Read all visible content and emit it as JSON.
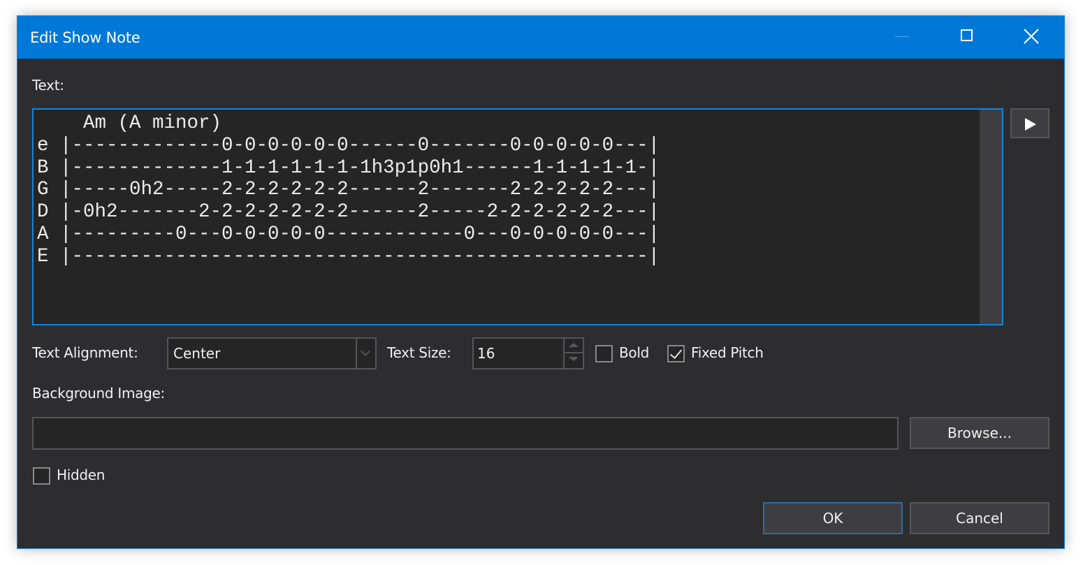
{
  "window": {
    "title": "Edit Show Note",
    "controls": {
      "minimize": "minimize-icon",
      "maximize": "maximize-icon",
      "close": "close-icon"
    },
    "accent_color": "#0078d7"
  },
  "text_field": {
    "label": "Text:",
    "lines": [
      "    Am (A minor)",
      "e |-------------0-0-0-0-0-0------0-------0-0-0-0-0---|",
      "B |-------------1-1-1-1-1-1-1h3p1p0h1------1-1-1-1-1-|",
      "G |-----0h2-----2-2-2-2-2-2------2-------2-2-2-2-2---|",
      "D |-0h2-------2-2-2-2-2-2-2------2-----2-2-2-2-2-2---|",
      "A |---------0---0-0-0-0-0------------0---0-0-0-0-0---|",
      "E |--------------------------------------------------|"
    ],
    "preview_button_icon": "play-icon"
  },
  "options": {
    "text_alignment_label": "Text Alignment:",
    "text_alignment_value": "Center",
    "text_size_label": "Text Size:",
    "text_size_value": "16",
    "bold_label": "Bold",
    "bold_checked": false,
    "fixed_pitch_label": "Fixed Pitch",
    "fixed_pitch_checked": true
  },
  "background_image": {
    "label": "Background Image:",
    "value": "",
    "browse_label": "Browse..."
  },
  "hidden": {
    "label": "Hidden",
    "checked": false
  },
  "footer": {
    "ok_label": "OK",
    "cancel_label": "Cancel"
  }
}
